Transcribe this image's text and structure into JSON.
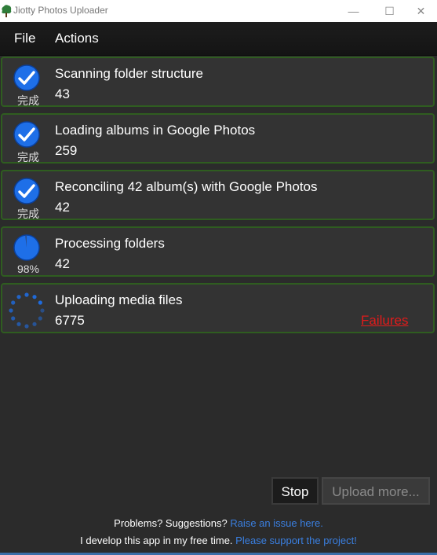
{
  "window": {
    "title": "Jiotty Photos Uploader",
    "minimize_glyph": "—",
    "maximize_glyph": "☐",
    "close_glyph": "✕"
  },
  "menu": {
    "file": "File",
    "actions": "Actions"
  },
  "tasks": [
    {
      "title": "Scanning folder structure",
      "count": "43",
      "status_text": "完成",
      "state": "complete"
    },
    {
      "title": "Loading albums in Google Photos",
      "count": "259",
      "status_text": "完成",
      "state": "complete"
    },
    {
      "title": "Reconciling 42 album(s) with Google Photos",
      "count": "42",
      "status_text": "完成",
      "state": "complete"
    },
    {
      "title": "Processing folders",
      "count": "42",
      "status_text": "98%",
      "state": "progress",
      "progress": 0.98
    },
    {
      "title": "Uploading media files",
      "count": "6775",
      "status_text": "",
      "state": "indeterminate",
      "failures_label": "Failures"
    }
  ],
  "buttons": {
    "stop": "Stop",
    "upload_more": "Upload more..."
  },
  "footer": {
    "line1_text": "Problems? Suggestions?",
    "line1_link": "Raise an issue here.",
    "line2_text": "I develop this app in my free time.",
    "line2_link": "Please support the project!"
  },
  "colors": {
    "accent_blue": "#1e6fe8",
    "card_border": "#2f5d20",
    "failures_red": "#e01b1b",
    "link_blue": "#3a7fe0"
  }
}
